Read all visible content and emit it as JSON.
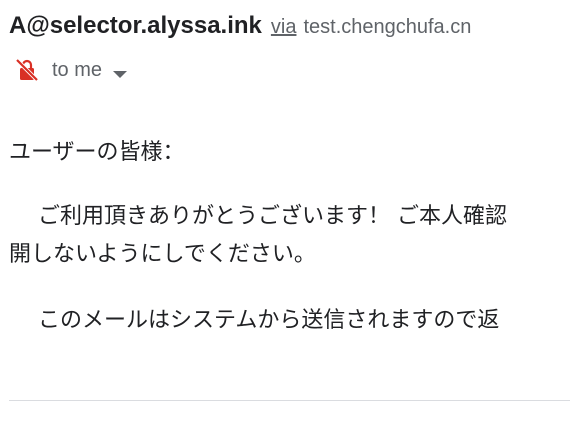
{
  "header": {
    "sender": "A@selector.alyssa.ink",
    "via_label": "via",
    "via_domain": "test.chengchufa.cn"
  },
  "recipient": {
    "label": "to me"
  },
  "icons": {
    "encryption": "lock-off-icon",
    "details": "chevron-down-icon"
  },
  "colors": {
    "warning_red": "#c5221f",
    "secondary_text": "#5f6368"
  },
  "message": {
    "greeting": "ユーザーの皆様：",
    "paragraph1_line1": "ご利用頂きありがとうございます！ ご本人確認",
    "paragraph1_line2": "開しないようにしでください。",
    "paragraph2": "このメールはシステムから送信されますので返"
  }
}
